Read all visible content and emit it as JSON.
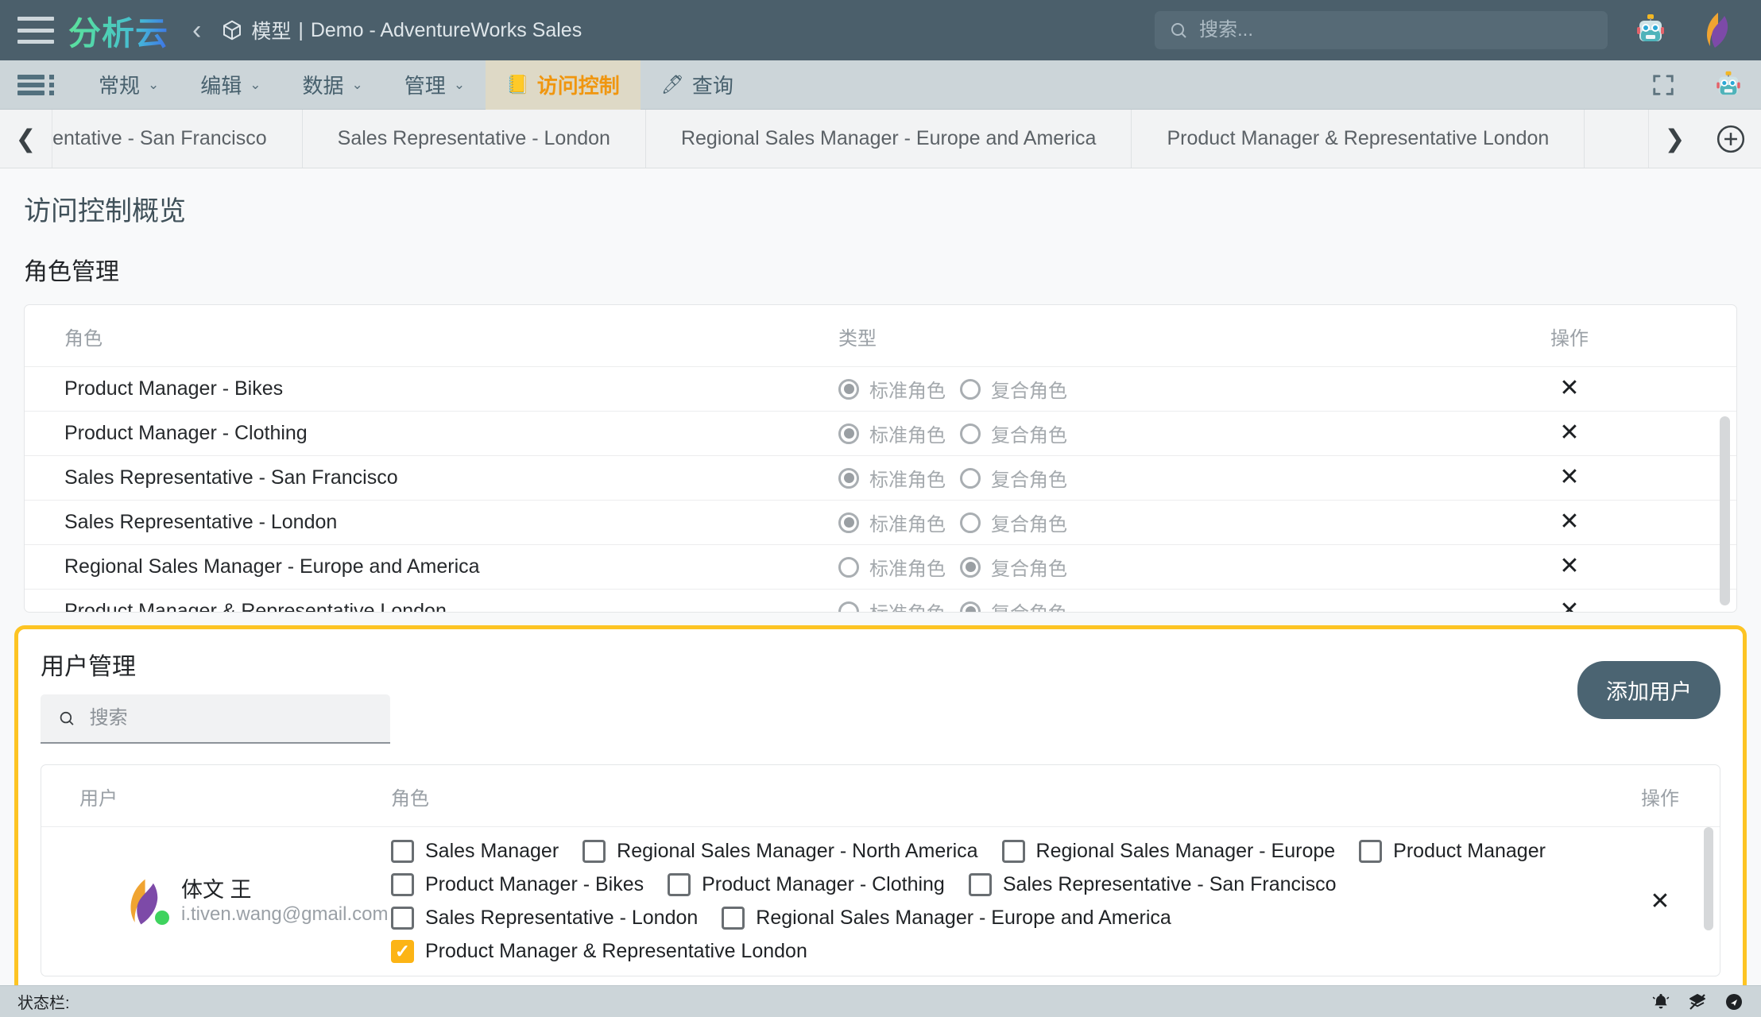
{
  "header": {
    "brand": "分析云",
    "breadcrumb_model": "模型",
    "breadcrumb_sep": "|",
    "breadcrumb_doc": "Demo - AdventureWorks Sales",
    "search_placeholder": "搜索...",
    "menu_icon": "hamburger-icon",
    "back_icon": "chevron-left-icon",
    "model_icon": "cube-icon",
    "search_icon": "search-icon",
    "robot_icon": "robot-avatar-icon",
    "logo_icon": "leaf-logo-icon",
    "bg_color": "#4b5f6b"
  },
  "menubar": {
    "grip_icon": "list-grip-icon",
    "items": [
      {
        "label": "常规",
        "caret": "⌄",
        "active": false,
        "icon": ""
      },
      {
        "label": "编辑",
        "caret": "⌄",
        "active": false,
        "icon": ""
      },
      {
        "label": "数据",
        "caret": "⌄",
        "active": false,
        "icon": ""
      },
      {
        "label": "管理",
        "caret": "⌄",
        "active": false,
        "icon": ""
      },
      {
        "label": "访问控制",
        "caret": "",
        "active": true,
        "icon": "📒"
      },
      {
        "label": "查询",
        "caret": "",
        "active": false,
        "icon": "🖊"
      }
    ],
    "fullscreen_icon": "fullscreen-icon",
    "robot_icon": "robot-avatar-icon",
    "active_color": "#f0960f",
    "active_bg": "#ded9c6"
  },
  "tabstrip": {
    "prev_icon": "chevron-left-icon",
    "next_icon": "chevron-right-icon",
    "add_icon": "plus-circle-icon",
    "tabs": [
      {
        "label": "Sales Representative - San Francisco",
        "clipped": true
      },
      {
        "label": "Sales Representative - London",
        "clipped": false
      },
      {
        "label": "Regional Sales Manager - Europe and America",
        "clipped": false
      },
      {
        "label": "Product Manager & Representative London",
        "clipped": false
      }
    ]
  },
  "page": {
    "title": "访问控制概览",
    "role_section_title": "角色管理",
    "user_section_title": "用户管理"
  },
  "role_table": {
    "headers": {
      "role": "角色",
      "type": "类型",
      "action": "操作"
    },
    "type_options": {
      "standard": "标准角色",
      "composite": "复合角色"
    },
    "delete_icon": "close-x-icon",
    "rows": [
      {
        "name": "Product Manager - Bikes",
        "type": "standard"
      },
      {
        "name": "Product Manager - Clothing",
        "type": "standard"
      },
      {
        "name": "Sales Representative - San Francisco",
        "type": "standard"
      },
      {
        "name": "Sales Representative - London",
        "type": "standard"
      },
      {
        "name": "Regional Sales Manager - Europe and America",
        "type": "composite"
      },
      {
        "name": "Product Manager & Representative London",
        "type": "composite"
      }
    ]
  },
  "user_section": {
    "highlight_color": "#fdc423",
    "search_placeholder": "搜索",
    "search_value": "",
    "search_icon": "search-icon",
    "add_user_label": "添加用户",
    "headers": {
      "user": "用户",
      "roles": "角色",
      "action": "操作"
    },
    "delete_icon": "close-x-icon",
    "users": [
      {
        "name": "体文 王",
        "email": "i.tiven.wang@gmail.com",
        "avatar_icon": "leaf-avatar-icon",
        "online": true,
        "roles": [
          {
            "label": "Sales Manager",
            "checked": false
          },
          {
            "label": "Regional Sales Manager - North America",
            "checked": false
          },
          {
            "label": "Regional Sales Manager - Europe",
            "checked": false
          },
          {
            "label": "Product Manager",
            "checked": false
          },
          {
            "label": "Product Manager - Bikes",
            "checked": false
          },
          {
            "label": "Product Manager - Clothing",
            "checked": false
          },
          {
            "label": "Sales Representative - San Francisco",
            "checked": false
          },
          {
            "label": "Sales Representative - London",
            "checked": false
          },
          {
            "label": "Regional Sales Manager - Europe and America",
            "checked": false
          },
          {
            "label": "Product Manager & Representative London",
            "checked": true
          }
        ]
      }
    ]
  },
  "statusbar": {
    "label": "状态栏:",
    "icons": [
      "bell-icon",
      "layers-off-icon",
      "navigation-circle-icon"
    ]
  }
}
